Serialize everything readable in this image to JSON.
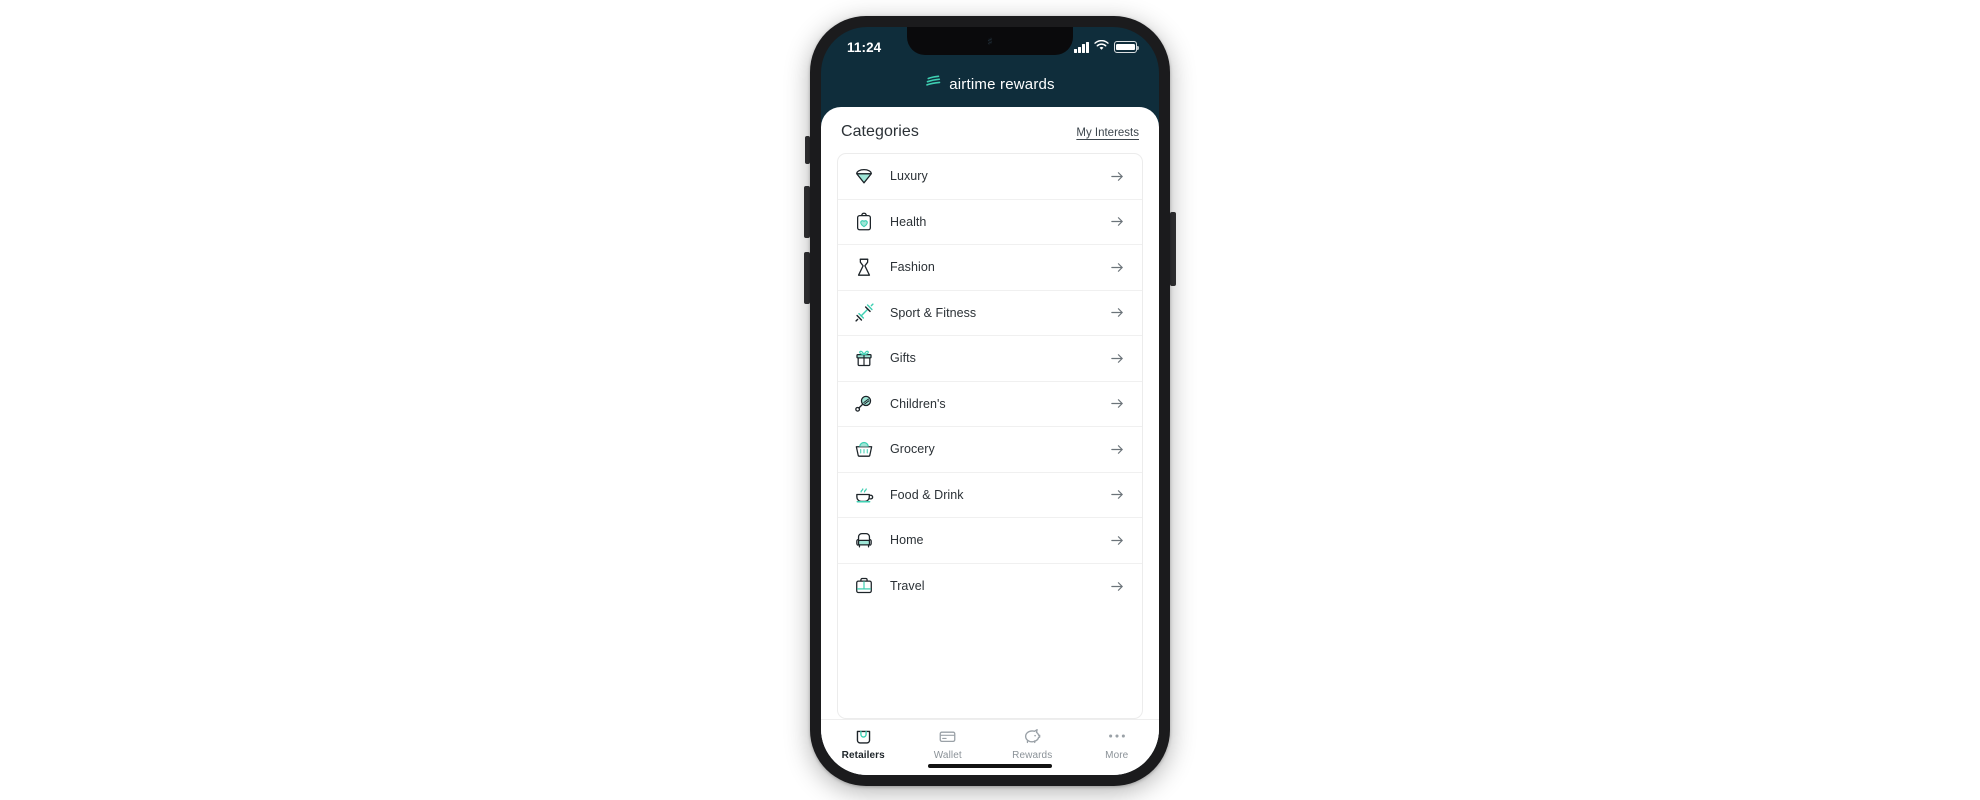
{
  "device": {
    "status_bar": {
      "time": "11:24",
      "signal_icon": "cellular-signal-icon",
      "wifi_icon": "wifi-icon",
      "battery_icon": "battery-full-icon"
    },
    "home_indicator": "home-indicator"
  },
  "app": {
    "brand_name": "airtime rewards",
    "brand_logo_icon": "airtime-waves-logo-icon",
    "header_bg": "#0f2d3b",
    "accent_color": "#3ecfb2",
    "text_color": "#2b3136"
  },
  "screen": {
    "title": "Categories",
    "my_interests_label": "My Interests"
  },
  "categories": [
    {
      "label": "Luxury",
      "icon": "diamond-icon",
      "arrow": "arrow-right-icon"
    },
    {
      "label": "Health",
      "icon": "clipboard-heart-icon",
      "arrow": "arrow-right-icon"
    },
    {
      "label": "Fashion",
      "icon": "dress-icon",
      "arrow": "arrow-right-icon"
    },
    {
      "label": "Sport & Fitness",
      "icon": "dumbbell-icon",
      "arrow": "arrow-right-icon"
    },
    {
      "label": "Gifts",
      "icon": "gift-box-icon",
      "arrow": "arrow-right-icon"
    },
    {
      "label": "Children's",
      "icon": "baby-rattle-icon",
      "arrow": "arrow-right-icon"
    },
    {
      "label": "Grocery",
      "icon": "shopping-basket-icon",
      "arrow": "arrow-right-icon"
    },
    {
      "label": "Food & Drink",
      "icon": "coffee-cup-icon",
      "arrow": "arrow-right-icon"
    },
    {
      "label": "Home",
      "icon": "armchair-icon",
      "arrow": "arrow-right-icon"
    },
    {
      "label": "Travel",
      "icon": "suitcase-icon",
      "arrow": "arrow-right-icon"
    }
  ],
  "tabbar": {
    "items": [
      {
        "label": "Retailers",
        "icon": "shopping-bag-icon",
        "active": true
      },
      {
        "label": "Wallet",
        "icon": "card-icon",
        "active": false
      },
      {
        "label": "Rewards",
        "icon": "piggy-bank-icon",
        "active": false
      },
      {
        "label": "More",
        "icon": "ellipsis-icon",
        "active": false
      }
    ]
  }
}
